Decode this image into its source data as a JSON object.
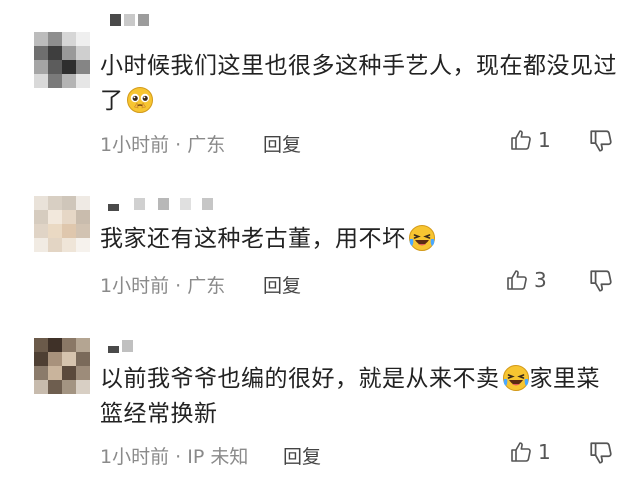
{
  "comments": [
    {
      "text": "小时候我们这里也很多这种手艺人，现在都没见过了",
      "emoji": "pleading-face-icon",
      "time": "1小时前",
      "location": "广东",
      "reply_label": "回复",
      "likes": "1"
    },
    {
      "text": "我家还有这种老古董，用不坏",
      "emoji": "laughing-tears-icon",
      "time": "1小时前",
      "location": "广东",
      "reply_label": "回复",
      "likes": "3"
    },
    {
      "text": "以前我爷爷也编的很好，就是从来不卖",
      "text_after_emoji": "家里菜篮经常换新",
      "emoji": "laughing-tears-icon",
      "time": "1小时前",
      "location": "IP 未知",
      "reply_label": "回复",
      "likes": "1"
    }
  ],
  "separator": "·",
  "colors": {
    "text": "#222222",
    "meta": "#8a8a8a",
    "icon": "#555555",
    "emoji_yellow": "#f7c531"
  }
}
